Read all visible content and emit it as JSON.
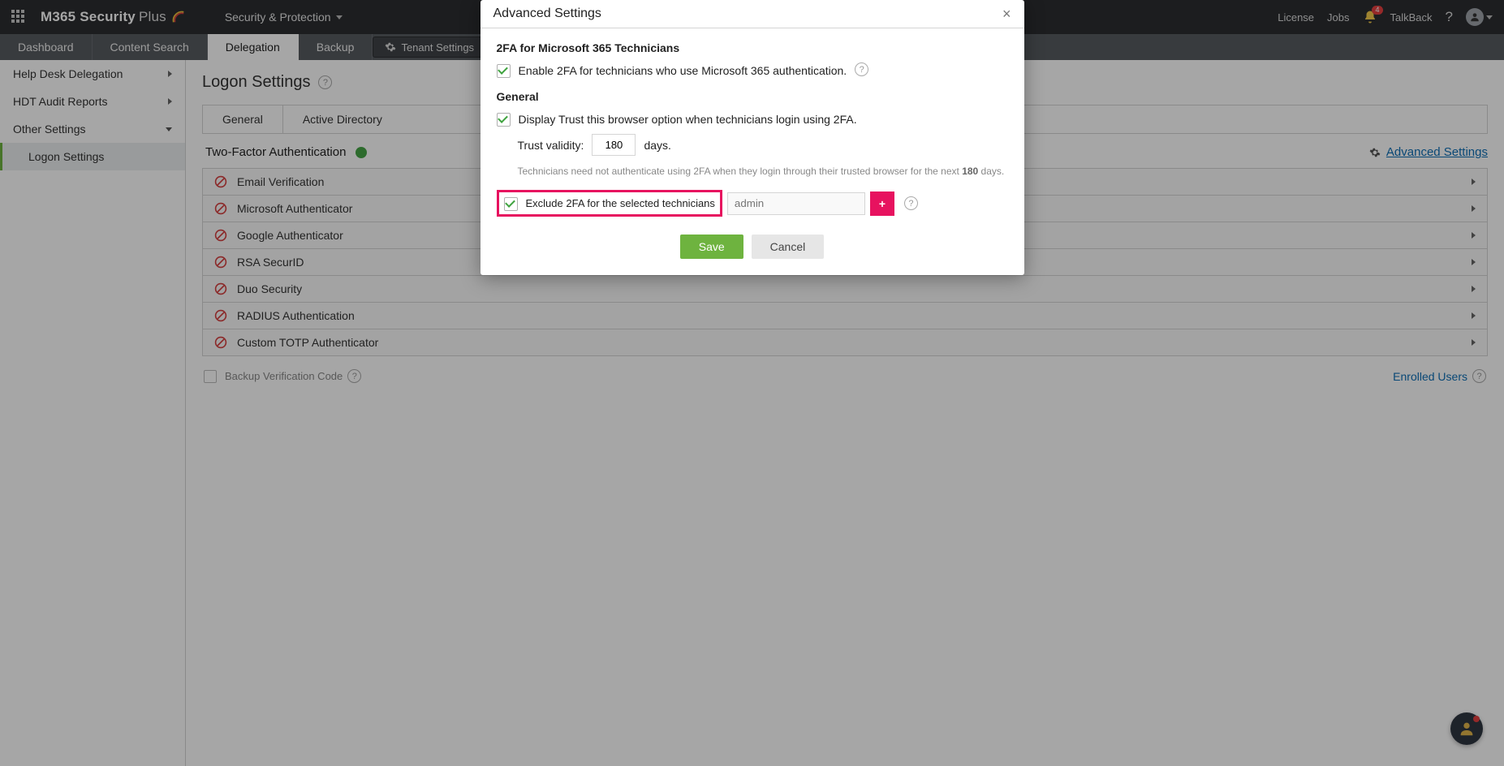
{
  "topbar": {
    "logo_main": "M365 Security",
    "logo_aux": "Plus",
    "menu_label": "Security & Protection",
    "links": {
      "license": "License",
      "jobs": "Jobs",
      "talkback": "TalkBack"
    },
    "notif_count": "4"
  },
  "tabs": {
    "items": [
      "Dashboard",
      "Content Search",
      "Delegation",
      "Backup"
    ],
    "active_index": 2,
    "tenant_btn": "Tenant Settings"
  },
  "sidebar": {
    "items": [
      {
        "label": "Help Desk Delegation",
        "type": "parent"
      },
      {
        "label": "HDT Audit Reports",
        "type": "parent"
      },
      {
        "label": "Other Settings",
        "type": "parent-open"
      },
      {
        "label": "Logon Settings",
        "type": "child",
        "active": true
      }
    ]
  },
  "page": {
    "title": "Logon Settings",
    "inner_tabs": [
      "General",
      "Active Directory"
    ],
    "tfa_label": "Two-Factor Authentication",
    "adv_settings_link": "Advanced Settings",
    "methods": [
      "Email Verification",
      "Microsoft Authenticator",
      "Google Authenticator",
      "RSA SecurID",
      "Duo Security",
      "RADIUS Authentication",
      "Custom TOTP Authenticator"
    ],
    "backup_label": "Backup Verification Code",
    "enrolled_link": "Enrolled Users"
  },
  "modal": {
    "title": "Advanced Settings",
    "sect1": "2FA for Microsoft 365 Technicians",
    "row1": "Enable 2FA for technicians who use Microsoft 365 authentication.",
    "sect2": "General",
    "row2": "Display Trust this browser option when technicians login using 2FA.",
    "trust_label": "Trust validity:",
    "trust_value": "180",
    "trust_unit": "days.",
    "note_pre": "Technicians need not authenticate using 2FA when they login through their trusted browser for the next ",
    "note_bold": "180",
    "note_post": " days.",
    "row3": "Exclude 2FA for the selected technicians",
    "tech_placeholder": "admin",
    "save": "Save",
    "cancel": "Cancel"
  }
}
